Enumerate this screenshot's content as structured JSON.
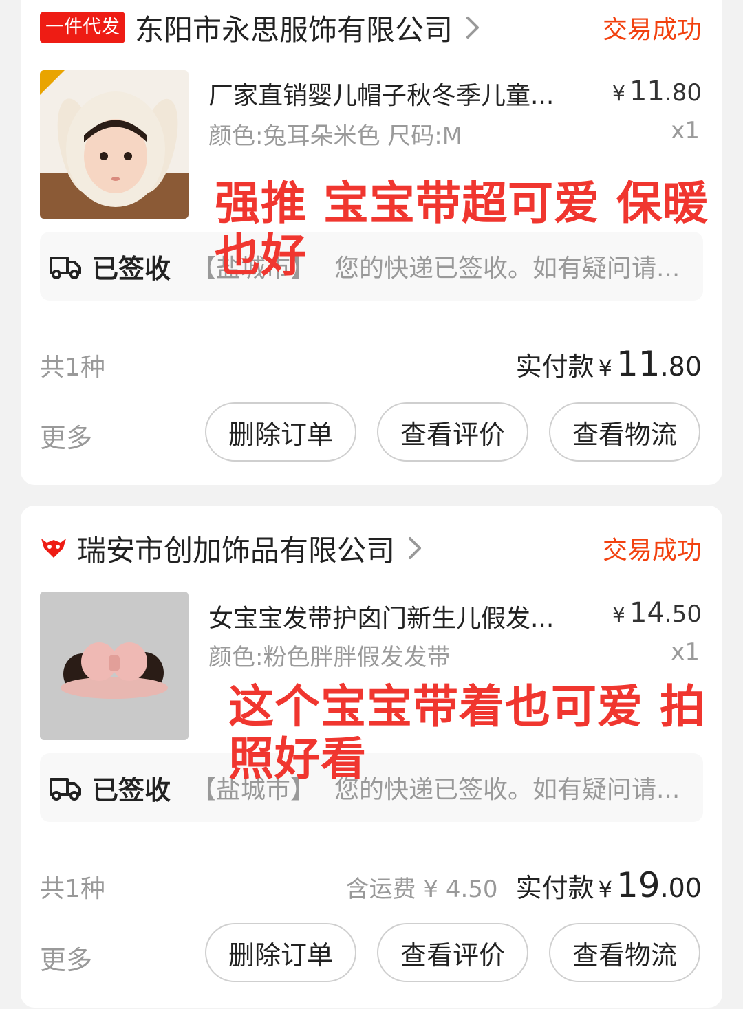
{
  "orders": [
    {
      "badge": "一件代发",
      "store": "东阳市永思服饰有限公司",
      "status": "交易成功",
      "product": {
        "title": "厂家直销婴儿帽子秋冬季儿童...",
        "price_currency": "¥",
        "price_int": "11",
        "price_dec": ".80",
        "variant": "颜色:兔耳朵米色 尺码:M",
        "qty": "x1",
        "image": "baby-hat-photo"
      },
      "overlay": [
        "强推 宝宝带超可爱 保暖",
        "也好"
      ],
      "logistics": {
        "status": "已签收",
        "city": "【盐城市】",
        "message": "您的快递已签收。如有疑问请..."
      },
      "count": "共1种",
      "shipping": "",
      "total_label": "实付款",
      "total_currency": "¥",
      "total_int": "11",
      "total_dec": ".80",
      "more": "更多",
      "buttons": {
        "delete": "删除订单",
        "review": "查看评价",
        "track": "查看物流"
      }
    },
    {
      "badge": "",
      "store": "瑞安市创加饰品有限公司",
      "status": "交易成功",
      "product": {
        "title": "女宝宝发带护囟门新生儿假发...",
        "price_currency": "¥",
        "price_int": "14",
        "price_dec": ".50",
        "variant": "颜色:粉色胖胖假发发带",
        "qty": "x1",
        "image": "wig-headband-photo"
      },
      "overlay": [
        "这个宝宝带着也可爱 拍",
        "照好看"
      ],
      "logistics": {
        "status": "已签收",
        "city": "【盐城市】",
        "message": "您的快递已签收。如有疑问请..."
      },
      "count": "共1种",
      "shipping": "含运费 ¥ 4.50",
      "total_label": "实付款",
      "total_currency": "¥",
      "total_int": "19",
      "total_dec": ".00",
      "more": "更多",
      "buttons": {
        "delete": "删除订单",
        "review": "查看评价",
        "track": "查看物流"
      }
    }
  ],
  "colors": {
    "accent": "#f2410f",
    "overlay": "#f0362f",
    "badge": "#ee1c14"
  }
}
